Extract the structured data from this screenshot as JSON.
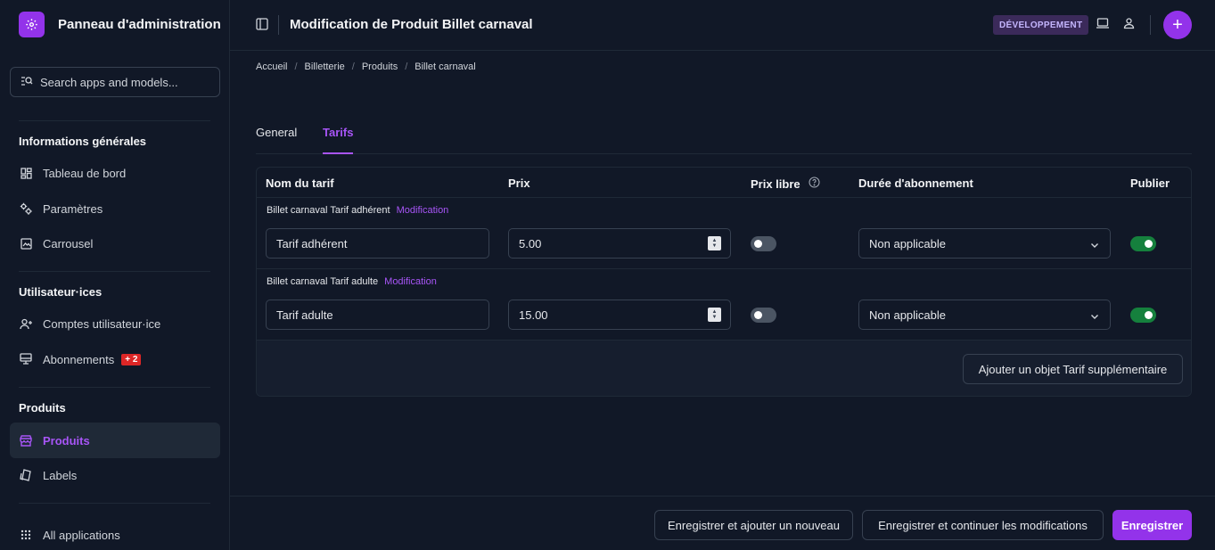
{
  "brand": {
    "title": "Panneau d'administration"
  },
  "sidebar": {
    "search_placeholder": "Search apps and models...",
    "sections": [
      {
        "heading": "Informations générales",
        "items": [
          {
            "label": "Tableau de bord",
            "icon": "dashboard-icon"
          },
          {
            "label": "Paramètres",
            "icon": "settings-icon"
          },
          {
            "label": "Carrousel",
            "icon": "carousel-icon"
          }
        ]
      },
      {
        "heading": "Utilisateur·ices",
        "items": [
          {
            "label": "Comptes utilisateur·ice",
            "icon": "user-add-icon"
          },
          {
            "label": "Abonnements",
            "icon": "subscription-icon",
            "badge": "+ 2"
          }
        ]
      },
      {
        "heading": "Produits",
        "items": [
          {
            "label": "Produits",
            "icon": "store-icon",
            "active": true
          },
          {
            "label": "Labels",
            "icon": "label-icon"
          }
        ]
      }
    ],
    "all_apps": "All applications"
  },
  "topbar": {
    "title": "Modification de Produit Billet carnaval",
    "env_badge": "DÉVELOPPEMENT"
  },
  "breadcrumb": [
    "Accueil",
    "Billetterie",
    "Produits",
    "Billet carnaval"
  ],
  "tabs": [
    {
      "label": "General",
      "active": false
    },
    {
      "label": "Tarifs",
      "active": true
    }
  ],
  "table": {
    "headers": {
      "name": "Nom du tarif",
      "price": "Prix",
      "free_price": "Prix libre",
      "duration": "Durée d'abonnement",
      "publish": "Publier"
    },
    "rows": [
      {
        "label": "Billet carnaval Tarif adhérent",
        "link": "Modification",
        "name": "Tarif adhérent",
        "price": "5.00",
        "free_price": false,
        "duration": "Non applicable",
        "publish": true
      },
      {
        "label": "Billet carnaval Tarif adulte",
        "link": "Modification",
        "name": "Tarif adulte",
        "price": "15.00",
        "free_price": false,
        "duration": "Non applicable",
        "publish": true
      }
    ],
    "add_button": "Ajouter un objet Tarif supplémentaire"
  },
  "actions": {
    "save_add": "Enregistrer et ajouter un nouveau",
    "save_continue": "Enregistrer et continuer les modifications",
    "save": "Enregistrer"
  },
  "colors": {
    "accent": "#9333ea",
    "background": "#111827",
    "toggle_on": "#15803d",
    "badge_red": "#dc2626"
  }
}
